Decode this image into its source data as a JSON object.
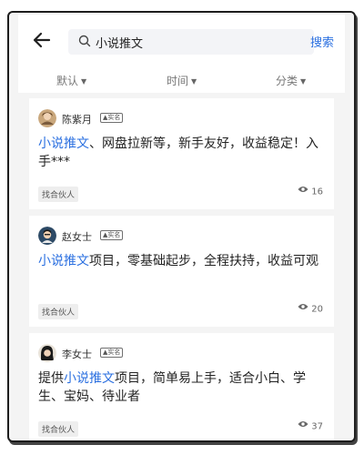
{
  "header": {
    "search_value": "小说推文",
    "search_button": "搜索"
  },
  "filters": [
    {
      "label": "默认"
    },
    {
      "label": "时间"
    },
    {
      "label": "分类"
    }
  ],
  "posts": [
    {
      "user": "陈紫月",
      "badge": "▲实名",
      "highlight": "小说推文",
      "text_after": "、网盘拉新等，新手友好，收益稳定！入手***",
      "text_before": "",
      "tag": "找合伙人",
      "views": "16"
    },
    {
      "user": "赵女士",
      "badge": "▲实名",
      "highlight": "小说推文",
      "text_after": "项目，零基础起步，全程扶持，收益可观",
      "text_before": "",
      "tag": "找合伙人",
      "views": "20"
    },
    {
      "user": "李女士",
      "badge": "▲实名",
      "text_before": "提供",
      "highlight": "小说推文",
      "text_after": "项目，简单易上手，适合小白、学生、宝妈、待业者",
      "tag": "找合伙人",
      "views": "37"
    }
  ],
  "colors": {
    "accent": "#2a6fe0",
    "background": "#f4f4f4"
  }
}
